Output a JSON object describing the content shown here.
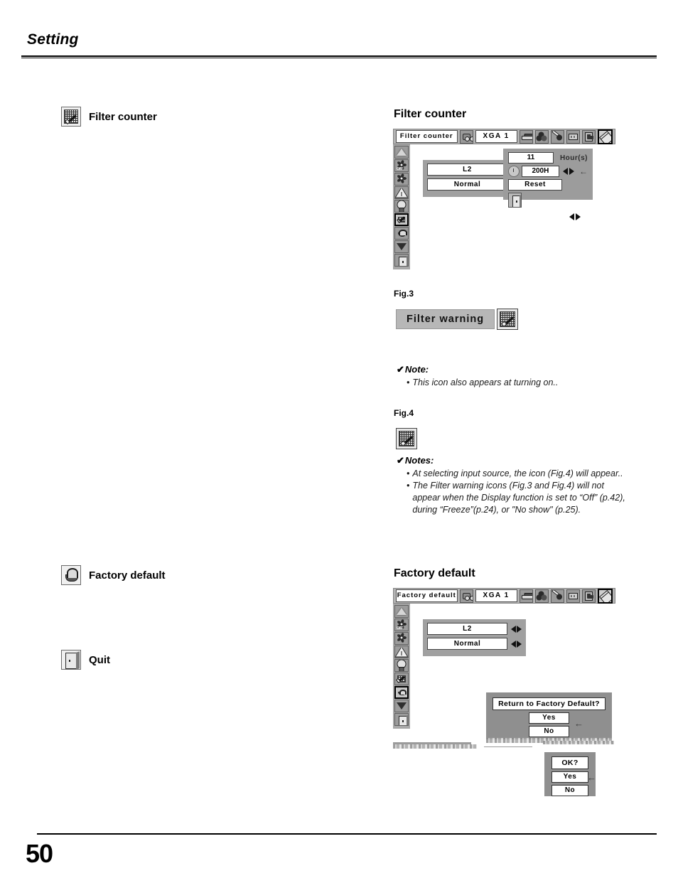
{
  "header": {
    "title": "Setting"
  },
  "page": {
    "number": "50"
  },
  "left_items": [
    {
      "label": "Filter counter",
      "icon": "filter-counter-icon"
    },
    {
      "label": "Factory default",
      "icon": "factory-default-icon"
    },
    {
      "label": "Quit",
      "icon": "quit-icon"
    }
  ],
  "filter_counter_section": {
    "title": "Filter counter",
    "osd": {
      "menu_name": "Filter counter",
      "source": "XGA 1",
      "bar_icons": [
        "input-source-icon",
        "computer-icon",
        "color-adjust-icon",
        "image-adjust-icon",
        "screen-icon",
        "sound-icon",
        "setting-icon"
      ],
      "selected_bar_icon": "setting-icon",
      "side_icons": [
        "keystone-icon",
        "fan-off-icon",
        "fan-control-icon",
        "warning-log-icon",
        "lamp-counter-icon",
        "filter-counter-icon",
        "factory-default-icon",
        "scroll-down-icon",
        "quit-icon"
      ],
      "selected_side_icon": "filter-counter-icon",
      "fields": [
        {
          "value": "L2"
        },
        {
          "value": "Normal"
        }
      ],
      "counter": {
        "hours_value": "11",
        "hours_unit": "Hour(s)",
        "timer_value": "200H",
        "reset_label": "Reset",
        "return_arrow": "←"
      }
    }
  },
  "fig3": {
    "label": "Fig.3",
    "banner_text": "Filter warning",
    "banner_icon": "filter-warning-icon"
  },
  "note1": {
    "head": "Note:",
    "check": "✔",
    "items": [
      "This icon also appears at turning on.."
    ]
  },
  "fig4": {
    "label": "Fig.4",
    "icon": "filter-warning-icon"
  },
  "notes2": {
    "head": "Notes:",
    "check": "✔",
    "items": [
      "At selecting input source, the icon (Fig.4) will appear..",
      "The Filter warning icons (Fig.3 and Fig.4) will not appear when the Display function is set to “Off” (p.42), during “Freeze”(p.24), or \"No show\" (p.25)."
    ]
  },
  "factory_default_section": {
    "title": "Factory default",
    "osd": {
      "menu_name": "Factory default",
      "source": "XGA 1",
      "selected_bar_icon": "setting-icon",
      "selected_side_icon": "factory-default-icon",
      "fields": [
        {
          "value": "L2"
        },
        {
          "value": "Normal"
        }
      ]
    },
    "confirm_dialog": {
      "title": "Return to Factory Default?",
      "yes_label": "Yes",
      "no_label": "No",
      "pointer": "←"
    },
    "ok_dialog": {
      "title": "OK?",
      "yes_label": "Yes",
      "no_label": "No",
      "pointer": "←"
    }
  }
}
